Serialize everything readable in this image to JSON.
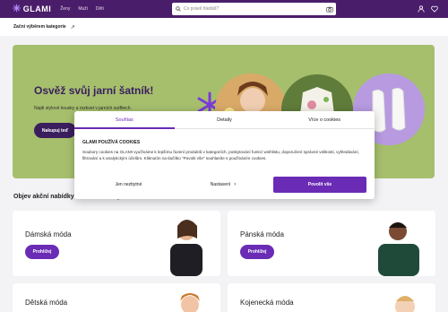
{
  "header": {
    "logo": "GLAMI",
    "nav": [
      "Ženy",
      "Muži",
      "Děti"
    ],
    "search_placeholder": "Co právě hledáš?"
  },
  "subbar": {
    "label": "Začni výběrem kategorie"
  },
  "hero": {
    "title": "Osvěž svůj jarní šatník!",
    "subtitle": "Najdi stylové kousky a rozkvet v jarních outfitech.",
    "button": "Nakupuj teď"
  },
  "section": {
    "title": "Objev akční nabídky a módní trendy"
  },
  "cards": [
    {
      "name": "Dámská móda",
      "button": "Prohlížej"
    },
    {
      "name": "Pánská móda",
      "button": "Prohlížej"
    },
    {
      "name": "Dětská móda"
    },
    {
      "name": "Kojenecká móda"
    }
  ],
  "cookies": {
    "tabs": [
      "Souhlas",
      "Detaily",
      "Více o cookies"
    ],
    "heading": "GLAMI POUŽÍVÁ COOKIES",
    "text": "Soubory cookies na GLAMI využíváme k lepšímu řazení produktů v kategoriích, poskytování funkcí wishlistu, doporučení správné velikosti, vyhledávání, filtrování a k analytickým účelům. Kliknutím na tlačítko \"Povolit vše\" souhlasíte s používáním cookies.",
    "reject": "Jen nezbytné",
    "settings": "Nastavení",
    "accept": "Povolit vše"
  },
  "colors": {
    "brand": "#4a1d6a",
    "accent": "#6a2bb5",
    "hero_bg": "#a6bf6d"
  }
}
